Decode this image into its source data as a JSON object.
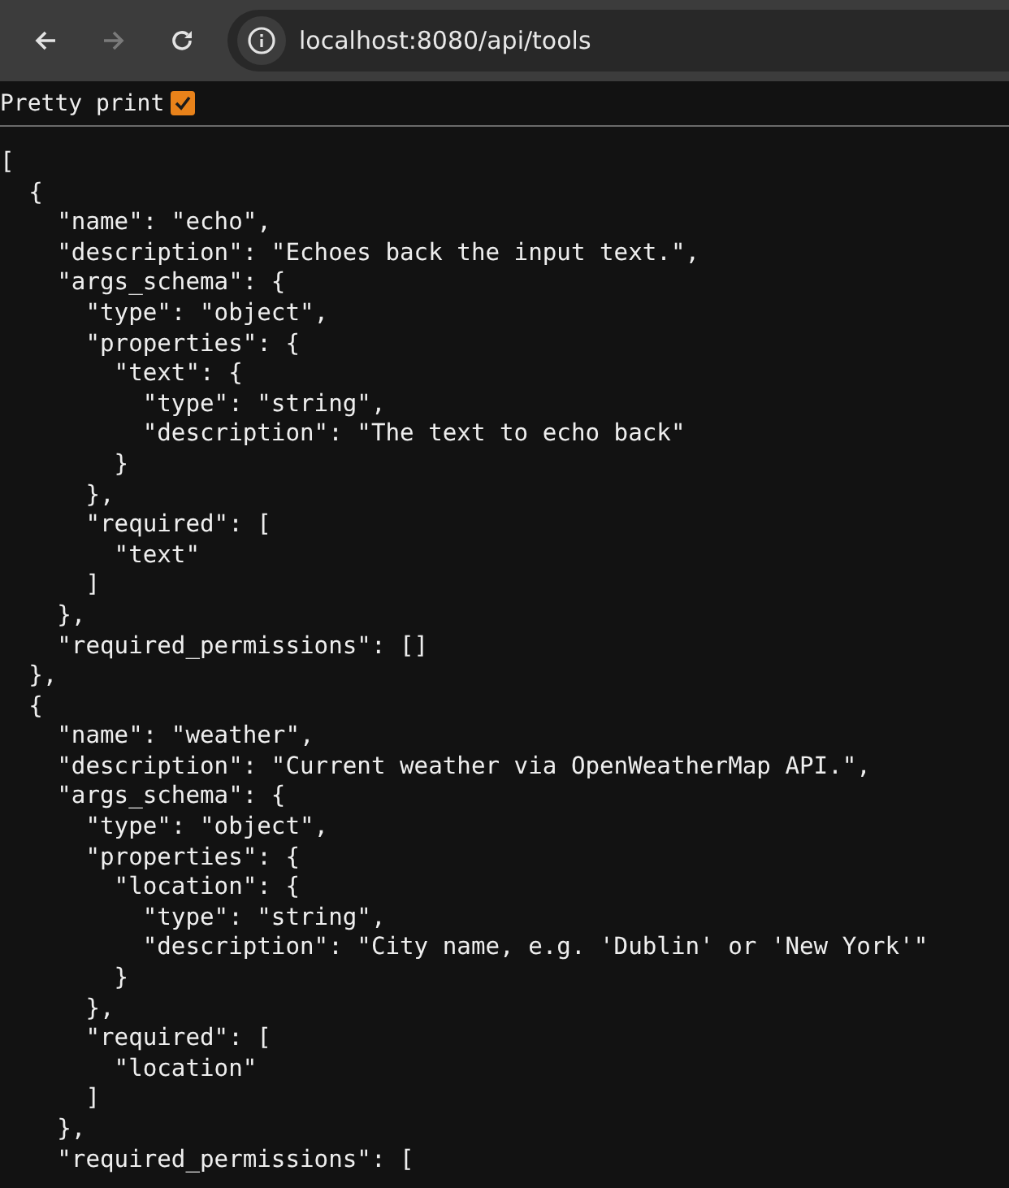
{
  "browser": {
    "url": "localhost:8080/api/tools",
    "forward_disabled": true
  },
  "pretty_print": {
    "label": "Pretty print",
    "checked": true
  },
  "lines": [
    "[",
    "  {",
    "    \"name\": \"echo\",",
    "    \"description\": \"Echoes back the input text.\",",
    "    \"args_schema\": {",
    "      \"type\": \"object\",",
    "      \"properties\": {",
    "        \"text\": {",
    "          \"type\": \"string\",",
    "          \"description\": \"The text to echo back\"",
    "        }",
    "      },",
    "      \"required\": [",
    "        \"text\"",
    "      ]",
    "    },",
    "    \"required_permissions\": []",
    "  },",
    "  {",
    "    \"name\": \"weather\",",
    "    \"description\": \"Current weather via OpenWeatherMap API.\",",
    "    \"args_schema\": {",
    "      \"type\": \"object\",",
    "      \"properties\": {",
    "        \"location\": {",
    "          \"type\": \"string\",",
    "          \"description\": \"City name, e.g. 'Dublin' or 'New York'\"",
    "        }",
    "      },",
    "      \"required\": [",
    "        \"location\"",
    "      ]",
    "    },",
    "    \"required_permissions\": ["
  ]
}
